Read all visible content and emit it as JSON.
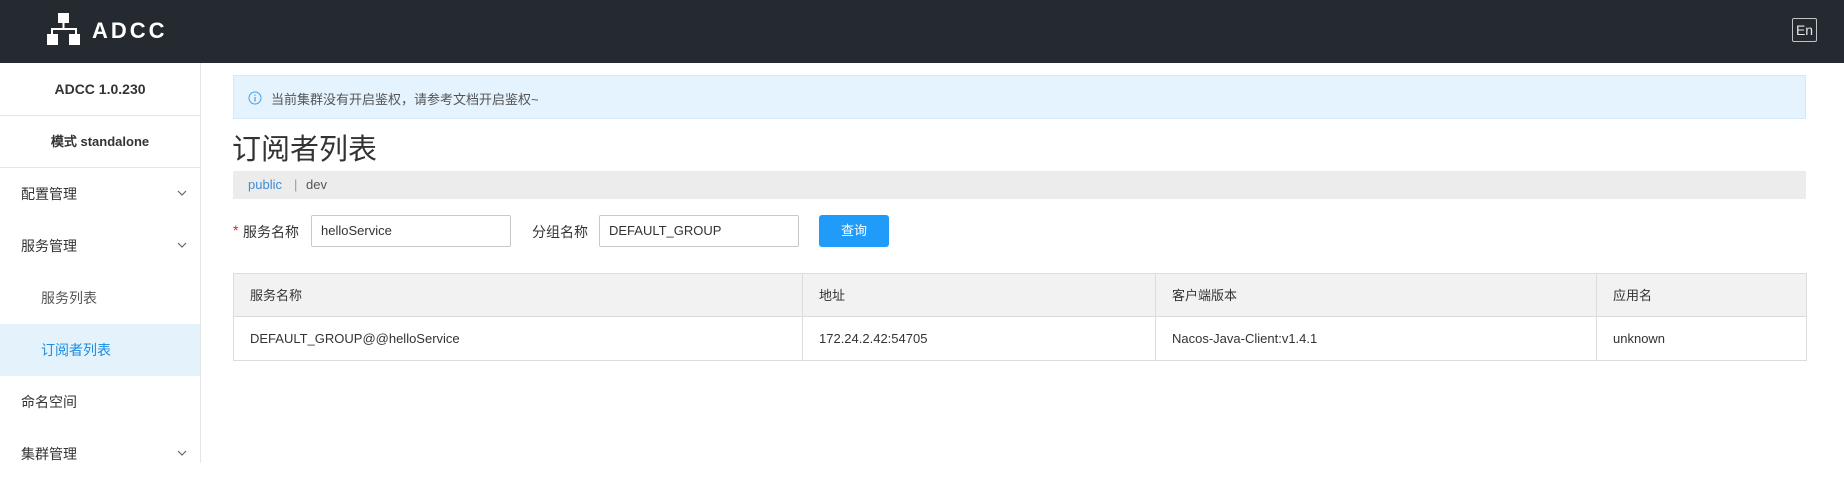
{
  "header": {
    "app_name": "ADCC",
    "lang_toggle": "En"
  },
  "sidebar": {
    "version": "ADCC 1.0.230",
    "mode": "模式 standalone",
    "items": [
      {
        "label": "配置管理",
        "expandable": true
      },
      {
        "label": "服务管理",
        "expandable": true
      },
      {
        "label": "服务列表",
        "sub": true
      },
      {
        "label": "订阅者列表",
        "sub": true,
        "active": true
      },
      {
        "label": "命名空间"
      },
      {
        "label": "集群管理",
        "expandable": true
      }
    ]
  },
  "notice": {
    "text": "当前集群没有开启鉴权，请参考文档开启鉴权~",
    "icon": "info-icon"
  },
  "page": {
    "title": "订阅者列表"
  },
  "breadcrumb": {
    "namespaces": [
      "public",
      "dev"
    ],
    "separator": "|"
  },
  "form": {
    "required_mark": "*",
    "service_label": "服务名称",
    "service_value": "helloService",
    "group_label": "分组名称",
    "group_value": "DEFAULT_GROUP",
    "query_button": "查询"
  },
  "table": {
    "headers": [
      "服务名称",
      "地址",
      "客户端版本",
      "应用名"
    ],
    "rows": [
      [
        "DEFAULT_GROUP@@helloService",
        "172.24.2.42:54705",
        "Nacos-Java-Client:v1.4.1",
        "unknown"
      ]
    ]
  },
  "colors": {
    "header_bg": "#252a30",
    "accent": "#209bfa",
    "active_bg": "#e4f2fc",
    "notice_bg": "#e4f3fe"
  }
}
